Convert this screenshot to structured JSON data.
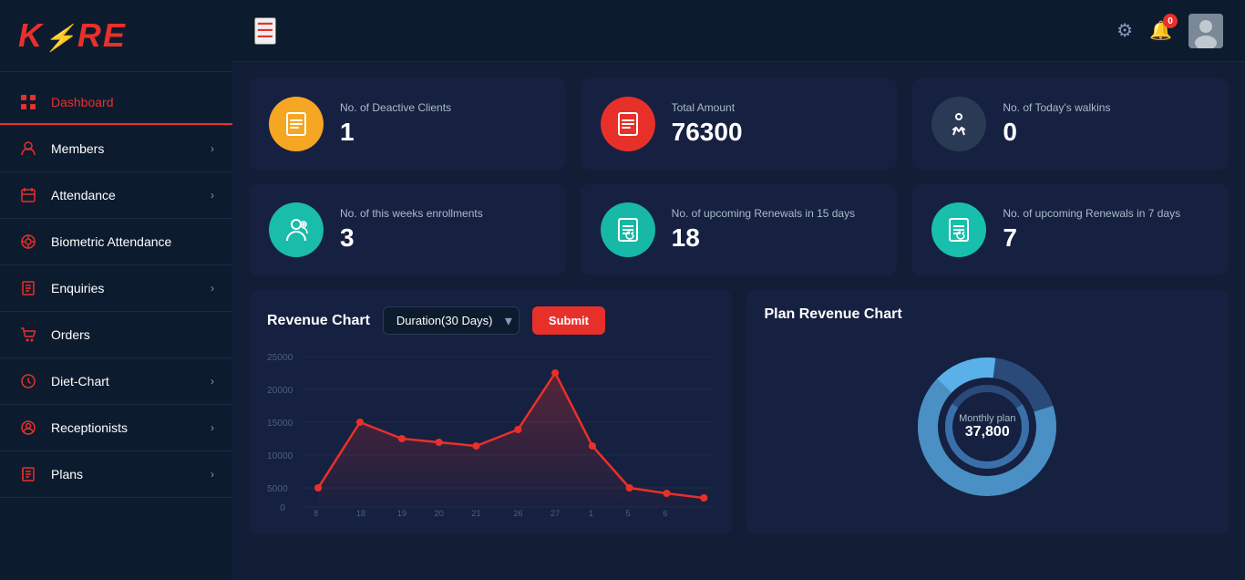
{
  "brand": {
    "name": "KORE"
  },
  "header": {
    "badge_count": "0"
  },
  "sidebar": {
    "items": [
      {
        "id": "dashboard",
        "label": "Dashboard",
        "icon": "▦",
        "active": true,
        "has_arrow": false
      },
      {
        "id": "members",
        "label": "Members",
        "icon": "👤",
        "active": false,
        "has_arrow": true
      },
      {
        "id": "attendance",
        "label": "Attendance",
        "icon": "🖥",
        "active": false,
        "has_arrow": true
      },
      {
        "id": "biometric",
        "label": "Biometric Attendance",
        "icon": "👁",
        "active": false,
        "has_arrow": false
      },
      {
        "id": "enquiries",
        "label": "Enquiries",
        "icon": "📋",
        "active": false,
        "has_arrow": true
      },
      {
        "id": "orders",
        "label": "Orders",
        "icon": "🛒",
        "active": false,
        "has_arrow": false
      },
      {
        "id": "diet-chart",
        "label": "Diet-Chart",
        "icon": "♥",
        "active": false,
        "has_arrow": true
      },
      {
        "id": "receptionists",
        "label": "Receptionists",
        "icon": "🌐",
        "active": false,
        "has_arrow": true
      },
      {
        "id": "plans",
        "label": "Plans",
        "icon": "📑",
        "active": false,
        "has_arrow": true
      }
    ]
  },
  "stats": [
    {
      "id": "deactive-clients",
      "label": "No. of Deactive Clients",
      "value": "1",
      "icon_color": "orange",
      "icon": "📋"
    },
    {
      "id": "total-amount",
      "label": "Total Amount",
      "value": "76300",
      "icon_color": "pink",
      "icon": "📄"
    },
    {
      "id": "todays-walkins",
      "label": "No. of Today's walkins",
      "value": "0",
      "icon_color": "dark",
      "icon": "🚶"
    },
    {
      "id": "week-enrollments",
      "label": "No. of this weeks enrollments",
      "value": "3",
      "icon_color": "teal",
      "icon": "👤"
    },
    {
      "id": "renewals-15",
      "label": "No. of upcoming Renewals in 15 days",
      "value": "18",
      "icon_color": "teal2",
      "icon": "🔄"
    },
    {
      "id": "renewals-7",
      "label": "No. of upcoming Renewals in 7 days",
      "value": "7",
      "icon_color": "teal3",
      "icon": "🔄"
    }
  ],
  "revenue_chart": {
    "title": "Revenue Chart",
    "duration_label": "Duration(30 Days)",
    "submit_label": "Submit",
    "y_labels": [
      "25000",
      "20000",
      "15000",
      "10000",
      "5000",
      "0"
    ],
    "x_labels": [
      "8",
      "18",
      "19",
      "20",
      "21",
      "26",
      "27",
      "1",
      "5",
      "6"
    ]
  },
  "plan_chart": {
    "title": "Plan Revenue Chart",
    "plan_name": "Monthly plan",
    "plan_value": "37,800"
  }
}
